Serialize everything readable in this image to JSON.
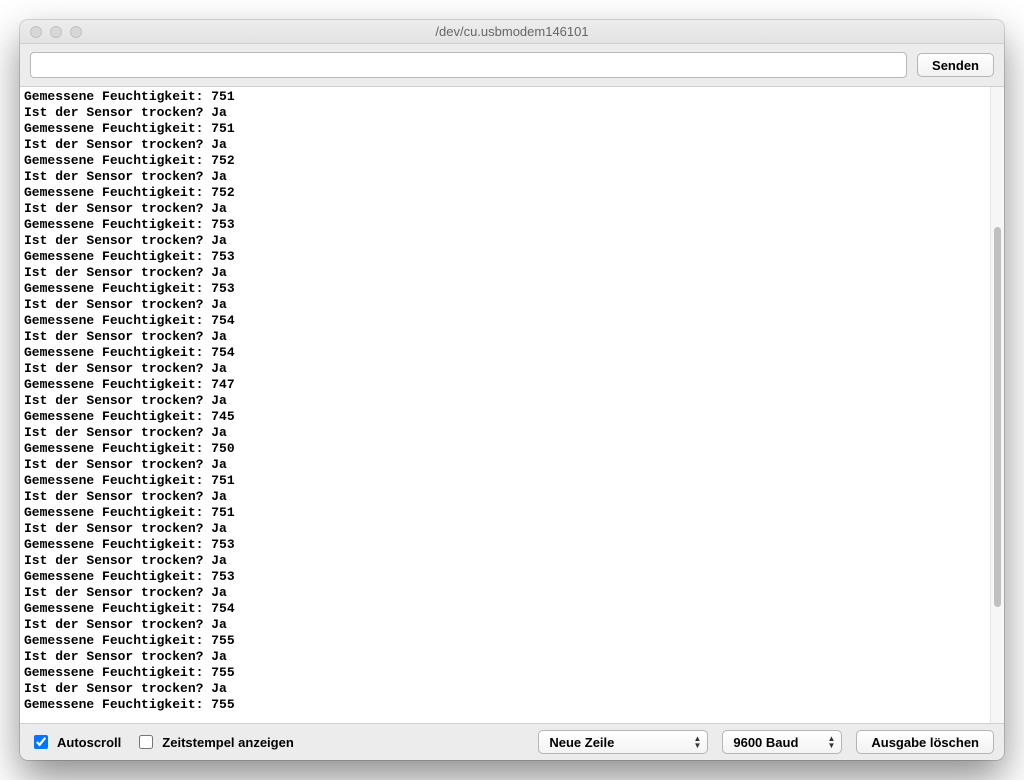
{
  "window": {
    "title": "/dev/cu.usbmodem146101"
  },
  "top": {
    "input_value": "",
    "input_placeholder": "",
    "send_label": "Senden"
  },
  "readings": [
    {
      "humidity": 751,
      "dry": "Ja"
    },
    {
      "humidity": 751,
      "dry": "Ja"
    },
    {
      "humidity": 752,
      "dry": "Ja"
    },
    {
      "humidity": 752,
      "dry": "Ja"
    },
    {
      "humidity": 753,
      "dry": "Ja"
    },
    {
      "humidity": 753,
      "dry": "Ja"
    },
    {
      "humidity": 753,
      "dry": "Ja"
    },
    {
      "humidity": 754,
      "dry": "Ja"
    },
    {
      "humidity": 754,
      "dry": "Ja"
    },
    {
      "humidity": 747,
      "dry": "Ja"
    },
    {
      "humidity": 745,
      "dry": "Ja"
    },
    {
      "humidity": 750,
      "dry": "Ja"
    },
    {
      "humidity": 751,
      "dry": "Ja"
    },
    {
      "humidity": 751,
      "dry": "Ja"
    },
    {
      "humidity": 753,
      "dry": "Ja"
    },
    {
      "humidity": 753,
      "dry": "Ja"
    },
    {
      "humidity": 754,
      "dry": "Ja"
    },
    {
      "humidity": 755,
      "dry": "Ja"
    },
    {
      "humidity": 755,
      "dry": "Ja"
    }
  ],
  "last_humidity_only": 755,
  "labels": {
    "humidity_prefix": "Gemessene Feuchtigkeit: ",
    "dry_prefix": "Ist der Sensor trocken? "
  },
  "bottom": {
    "autoscroll_label": "Autoscroll",
    "autoscroll_checked": true,
    "timestamp_label": "Zeitstempel anzeigen",
    "timestamp_checked": false,
    "line_ending_selected": "Neue Zeile",
    "baud_selected": "9600 Baud",
    "clear_label": "Ausgabe löschen"
  }
}
